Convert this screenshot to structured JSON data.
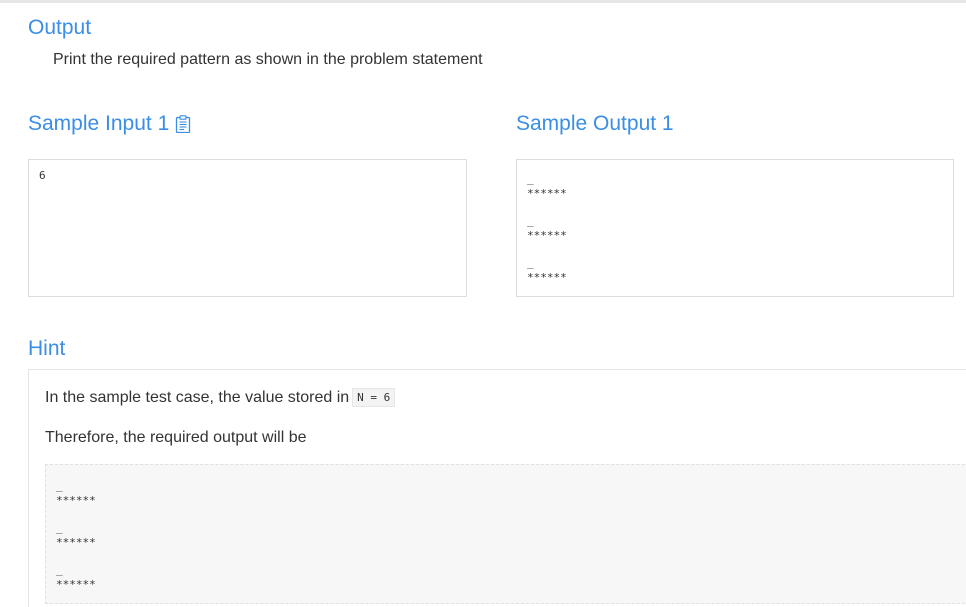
{
  "output_section": {
    "title": "Output",
    "description": "Print the required pattern as shown in the problem statement"
  },
  "sample_input": {
    "title": "Sample Input 1",
    "copy_icon": "clipboard-icon",
    "value": "6"
  },
  "sample_output": {
    "title": "Sample Output 1",
    "lines": [
      "_",
      "******",
      "_",
      "******",
      "_",
      "******"
    ]
  },
  "hint": {
    "title": "Hint",
    "text1": "In the sample test case, the value stored in",
    "code": "N = 6",
    "text2": "Therefore, the required output will be",
    "pre_lines": [
      "_",
      "******",
      "_",
      "******",
      "_",
      "******"
    ]
  },
  "colors": {
    "heading": "#3a8ee6",
    "text": "#333333",
    "border": "#dddddd"
  }
}
